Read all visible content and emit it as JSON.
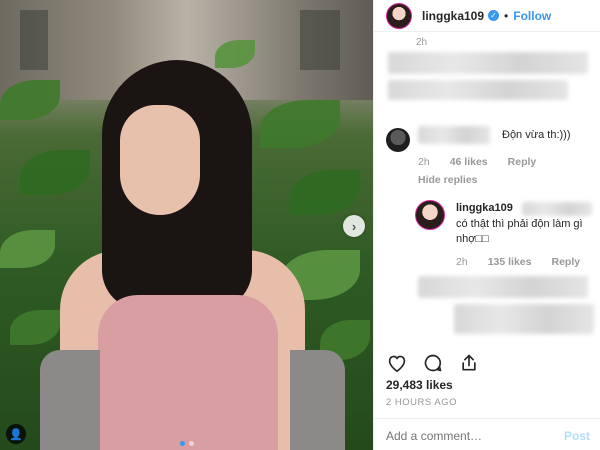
{
  "header": {
    "username": "linggka109",
    "separator": "•",
    "follow_label": "Follow"
  },
  "comments": {
    "top_time": "2h",
    "first": {
      "text": "Độn vừa th:)))",
      "time": "2h",
      "likes": "46 likes",
      "reply_label": "Reply",
      "hide_replies": "Hide replies"
    },
    "reply": {
      "username": "linggka109",
      "text": "có thật thì phải độn làm gì nhợ□□",
      "time": "2h",
      "likes": "135 likes",
      "reply_label": "Reply"
    }
  },
  "post": {
    "likes": "29,483 likes",
    "time_ago": "2 HOURS AGO",
    "add_comment_placeholder": "Add a comment…",
    "post_label": "Post"
  },
  "carousel": {
    "total": 2,
    "active": 0
  },
  "icons": {
    "like": "heart-icon",
    "comment": "comment-icon",
    "share": "share-icon",
    "verified": "verified-badge-icon",
    "next": "chevron-right-icon",
    "tag": "person-tag-icon"
  },
  "colors": {
    "accent": "#3897f0",
    "meta": "#999999",
    "text": "#262626"
  }
}
